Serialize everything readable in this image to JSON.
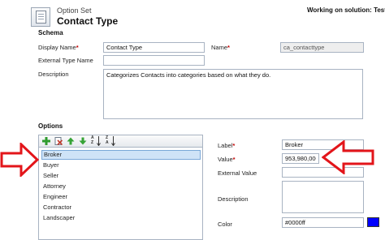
{
  "header": {
    "entity_type": "Option Set",
    "title": "Contact Type",
    "solution_status": "Working on solution: Testi"
  },
  "schema": {
    "section_title": "Schema",
    "display_name_label": "Display Name",
    "display_name_value": "Contact Type",
    "name_label": "Name",
    "name_value": "ca_contacttype",
    "external_type_name_label": "External Type Name",
    "external_type_name_value": "",
    "description_label": "Description",
    "description_value": "Categorizes Contacts into categories based on what they do."
  },
  "options": {
    "section_title": "Options",
    "toolbar": [
      "add-icon",
      "delete-icon",
      "move-up-icon",
      "move-down-icon",
      "sort-ascending-icon",
      "sort-descending-icon"
    ],
    "sort_labels": {
      "asc_top": "A",
      "asc_bottom": "Z",
      "desc_top": "Z",
      "desc_bottom": "A"
    },
    "items": [
      "Broker",
      "Buyer",
      "Seller",
      "Attorney",
      "Engineer",
      "Contractor",
      "Landscaper"
    ],
    "selected_index": 0
  },
  "detail": {
    "label_label": "Label",
    "label_value": "Broker",
    "value_label": "Value",
    "value_value": "953,980,000",
    "external_value_label": "External Value",
    "external_value_value": "",
    "description_label": "Description",
    "description_value": "",
    "color_label": "Color",
    "color_value": "#0000ff",
    "color_swatch": "#0000ff"
  },
  "annotations": {
    "arrow_color": "#e3151a"
  }
}
